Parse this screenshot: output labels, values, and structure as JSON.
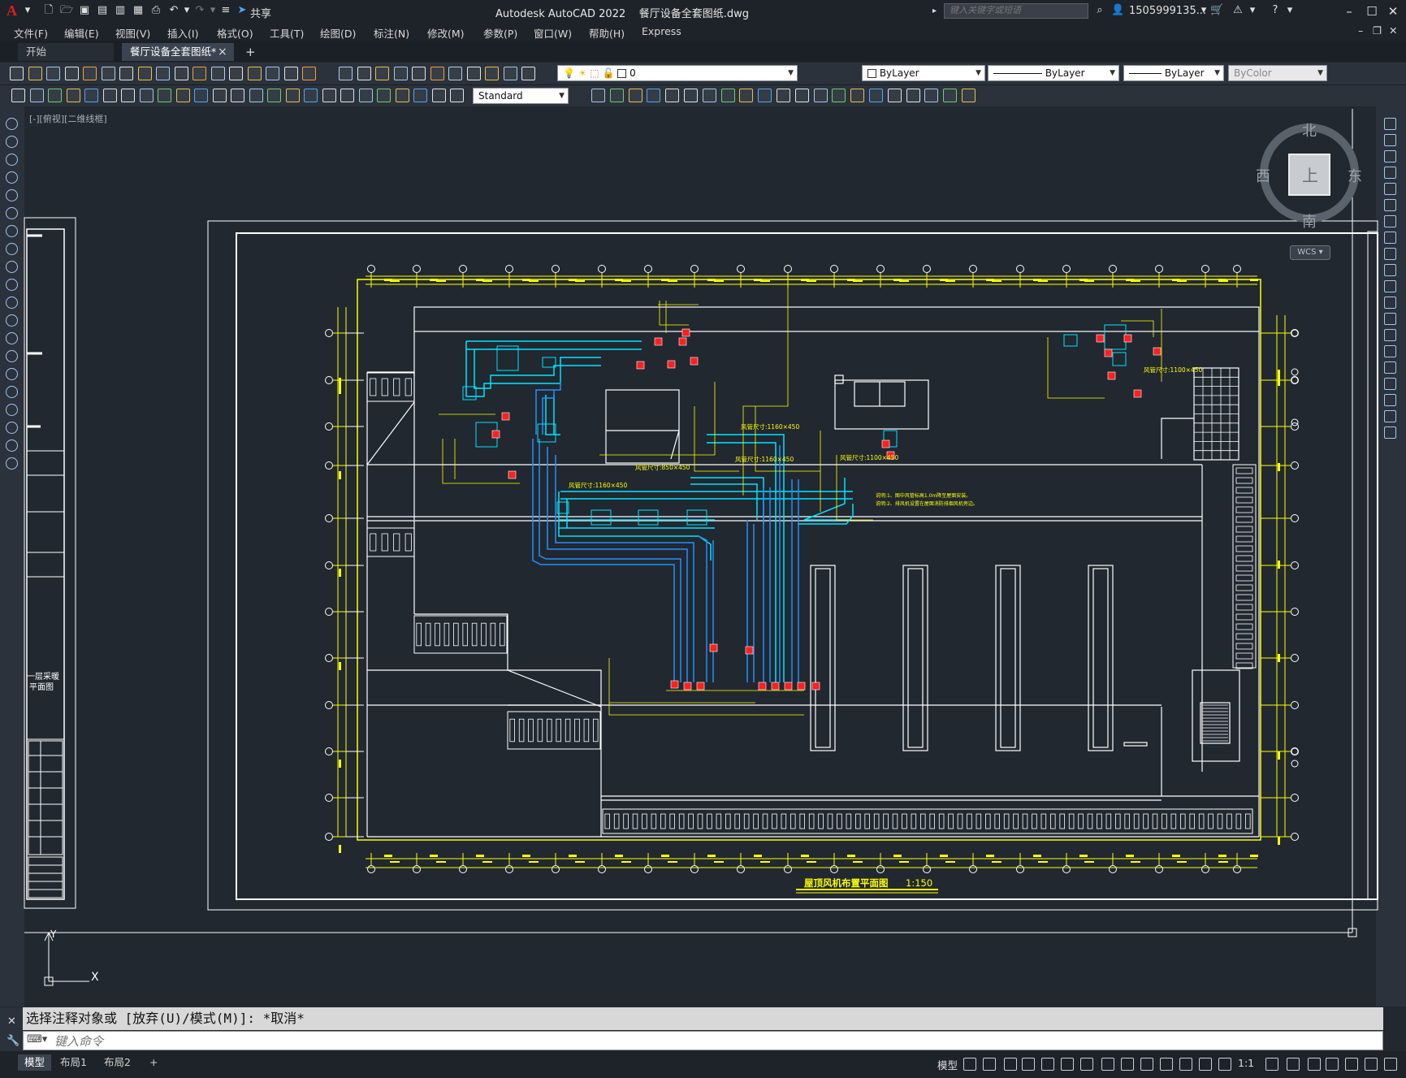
{
  "app": {
    "logo": "A",
    "title": "Autodesk AutoCAD 2022    餐厅设备全套图纸.dwg",
    "share_label": "共享",
    "search_placeholder": "键入关键字或短语",
    "user": "1505999135...",
    "colors": {
      "accent": "#e02020",
      "drawing_bg": "#212830",
      "yellow": "#ffff00",
      "cyan": "#00e5ff",
      "blue": "#2090ff",
      "red": "#ff2020"
    }
  },
  "menu": [
    "文件(F)",
    "编辑(E)",
    "视图(V)",
    "插入(I)",
    "格式(O)",
    "工具(T)",
    "绘图(D)",
    "标注(N)",
    "修改(M)",
    "参数(P)",
    "窗口(W)",
    "帮助(H)",
    "Express"
  ],
  "tabs": {
    "start": "开始",
    "active": "餐厅设备全套图纸*",
    "close": "×",
    "add": "+"
  },
  "toolbar": {
    "layer_value": "0",
    "color_value": "ByLayer",
    "linetype_value": "ByLayer",
    "lineweight_value": "ByLayer",
    "plotstyle_value": "ByColor",
    "textstyle_value": "Standard"
  },
  "viewport": {
    "label": "[-][俯视][二维线框]",
    "compass": {
      "north": "北",
      "south": "南",
      "east": "东",
      "west": "西",
      "top": "上"
    },
    "wcs": "WCS ▾",
    "ucs_y": "Y",
    "ucs_x": "X"
  },
  "drawing": {
    "title": "屋顶风机布置平面图",
    "scale": "1:150",
    "side_title_1": "一层采暖",
    "side_title_2": "平面图",
    "duct_labels": [
      "风管尺寸:1160×450",
      "风管尺寸:1160×450",
      "风管尺寸:1100×450",
      "风管尺寸:850×450",
      "风管尺寸:1160×450",
      "风管尺寸:1100×450"
    ],
    "notes": [
      "说明:1、图中风管标高1.0m降至屋面安装。",
      "说明:2、排风机设置在屋面消防排烟风机旁边。"
    ]
  },
  "command": {
    "output": "选择注释对象或 [放弃(U)/模式(M)]: *取消*",
    "input_placeholder": "键入命令"
  },
  "status": {
    "layouts": [
      "模型",
      "布局1",
      "布局2"
    ],
    "add_layout": "+",
    "model_label": "模型",
    "scale": "1:1"
  }
}
